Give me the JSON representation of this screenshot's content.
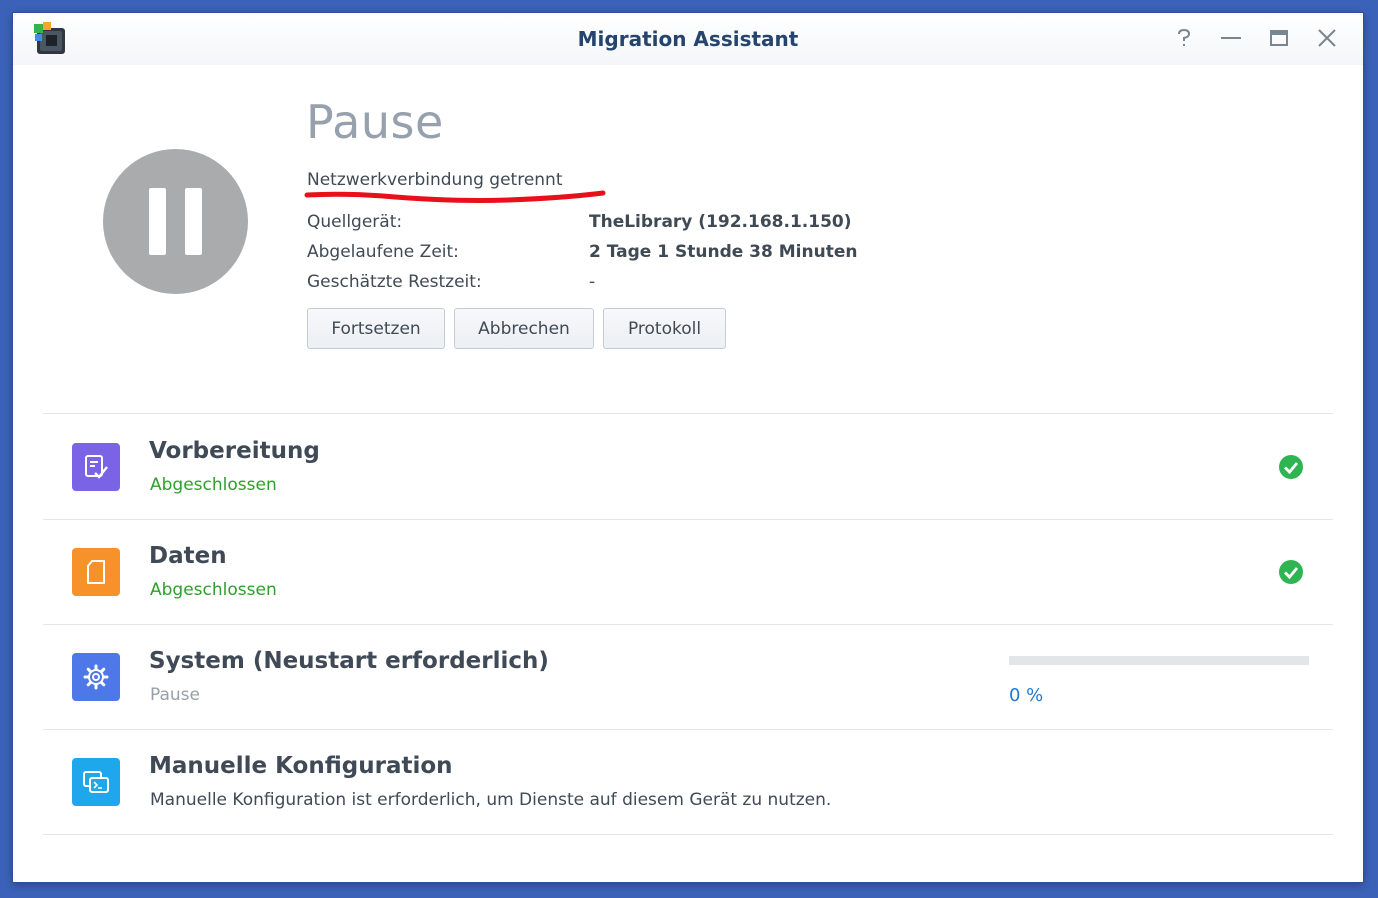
{
  "window": {
    "title": "Migration Assistant",
    "controls": [
      "help-icon",
      "minimize-icon",
      "maximize-icon",
      "close-icon"
    ]
  },
  "status": {
    "state_icon": "pause-icon",
    "title": "Pause",
    "subtitle": "Netzwerkverbindung getrennt",
    "annotation_color": "#e8101a"
  },
  "info": {
    "source_label": "Quellgerät:",
    "source_value": "TheLibrary (192.168.1.150)",
    "elapsed_label": "Abgelaufene Zeit:",
    "elapsed_value": "2 Tage 1 Stunde 38 Minuten",
    "remaining_label": "Geschätzte Restzeit:",
    "remaining_value": "-"
  },
  "buttons": {
    "resume": "Fortsetzen",
    "cancel": "Abbrechen",
    "log": "Protokoll"
  },
  "steps": [
    {
      "icon": "checklist-icon",
      "color": "#7b63e6",
      "title": "Vorbereitung",
      "status": "Abgeschlossen",
      "done": true
    },
    {
      "icon": "document-icon",
      "color": "#f7922b",
      "title": "Daten",
      "status": "Abgeschlossen",
      "done": true
    },
    {
      "icon": "gear-icon",
      "color": "#4e77e8",
      "title": "System (Neustart erforderlich)",
      "status": "Pause",
      "progress": 0,
      "progress_text": "0 %"
    },
    {
      "icon": "terminal-windows-icon",
      "color": "#1ea7ea",
      "title": "Manuelle Konfiguration",
      "status": "Manuelle Konfiguration ist erforderlich, um Dienste auf diesem Gerät zu nutzen."
    }
  ],
  "colors": {
    "accent": "#1f7ad2",
    "success": "#2eb552",
    "success_text": "#2ea02a"
  }
}
